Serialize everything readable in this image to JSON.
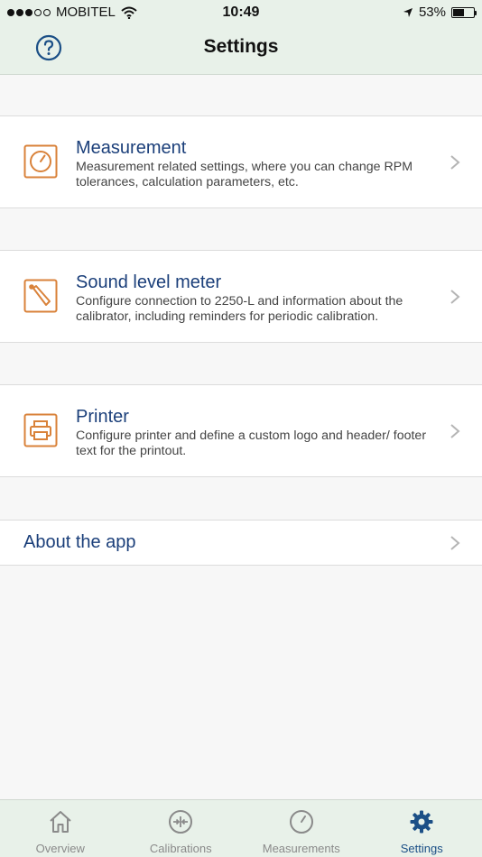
{
  "status_bar": {
    "carrier": "MOBITEL",
    "time": "10:49",
    "battery_text": "53%",
    "battery_level": 0.53,
    "signal_bars_filled": 3,
    "signal_bars_total": 5
  },
  "nav": {
    "title": "Settings",
    "help_icon": "question-circle-icon"
  },
  "settings": [
    {
      "key": "measurement",
      "title": "Measurement",
      "description": "Measurement related settings, where you can change RPM tolerances, calculation parameters, etc.",
      "icon": "gauge-icon"
    },
    {
      "key": "sound_level_meter",
      "title": "Sound level meter",
      "description": "Configure connection to 2250-L and information about the calibrator, including reminders for periodic calibration.",
      "icon": "sound-level-meter-icon"
    },
    {
      "key": "printer",
      "title": "Printer",
      "description": "Configure printer and define a custom logo and header/ footer text for the printout.",
      "icon": "printer-icon"
    }
  ],
  "about": {
    "label": "About the app"
  },
  "tabs": [
    {
      "label": "Overview",
      "icon": "home-icon",
      "active": false
    },
    {
      "label": "Calibrations",
      "icon": "calibration-icon",
      "active": false
    },
    {
      "label": "Measurements",
      "icon": "gauge-icon",
      "active": false
    },
    {
      "label": "Settings",
      "icon": "gear-icon",
      "active": true
    }
  ],
  "colors": {
    "accent": "#1b4f86",
    "title_blue": "#1b3f7a",
    "icon_orange": "#d9823a",
    "header_bg": "#e8f1e9"
  }
}
